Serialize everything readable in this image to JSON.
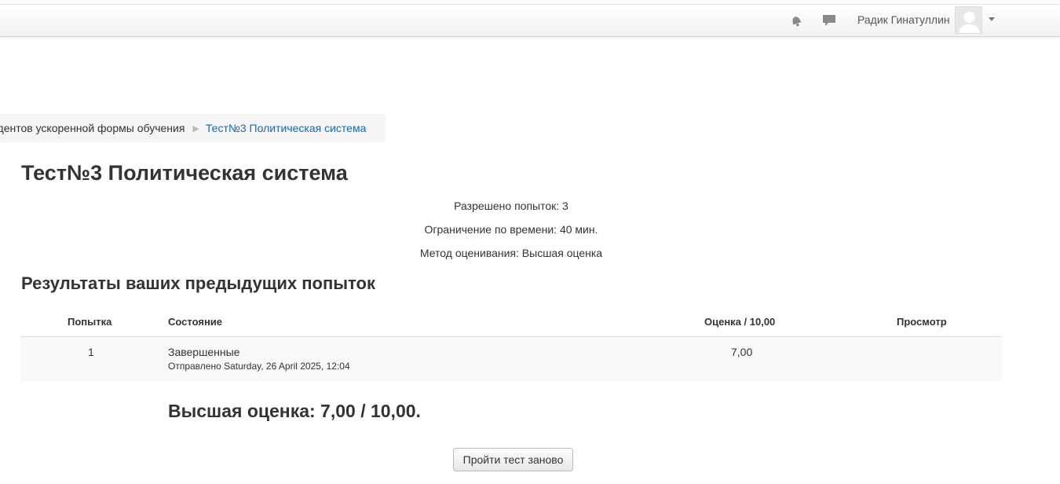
{
  "header": {
    "username": "Радик Гинатуллин",
    "icons": [
      "bell-icon",
      "message-icon",
      "avatar",
      "chevron-down-icon"
    ]
  },
  "breadcrumb": {
    "item_course": "удентов ускоренной формы обучения",
    "item_current": "Тест№3 Политическая система"
  },
  "quiz": {
    "title": "Тест№3 Политическая система",
    "attempts_allowed": "Разрешено попыток: 3",
    "time_limit": "Ограничение по времени: 40 мин.",
    "grading_method": "Метод оценивания: Высшая оценка"
  },
  "results": {
    "section_title": "Результаты ваших предыдущих попыток",
    "columns": {
      "attempt": "Попытка",
      "state": "Состояние",
      "grade": "Оценка / 10,00",
      "review": "Просмотр"
    },
    "rows": [
      {
        "attempt": "1",
        "state": "Завершенные",
        "submitted": "Отправлено Saturday, 26 April 2025, 12:04",
        "grade": "7,00",
        "review": ""
      }
    ],
    "best_grade": "Высшая оценка: 7,00 / 10,00."
  },
  "actions": {
    "retry_label": "Пройти тест заново"
  },
  "colors": {
    "link": "#0f6cbf",
    "text": "#333333",
    "row_background": "#f9f9f9",
    "breadcrumb_background": "#f5f5f5"
  }
}
